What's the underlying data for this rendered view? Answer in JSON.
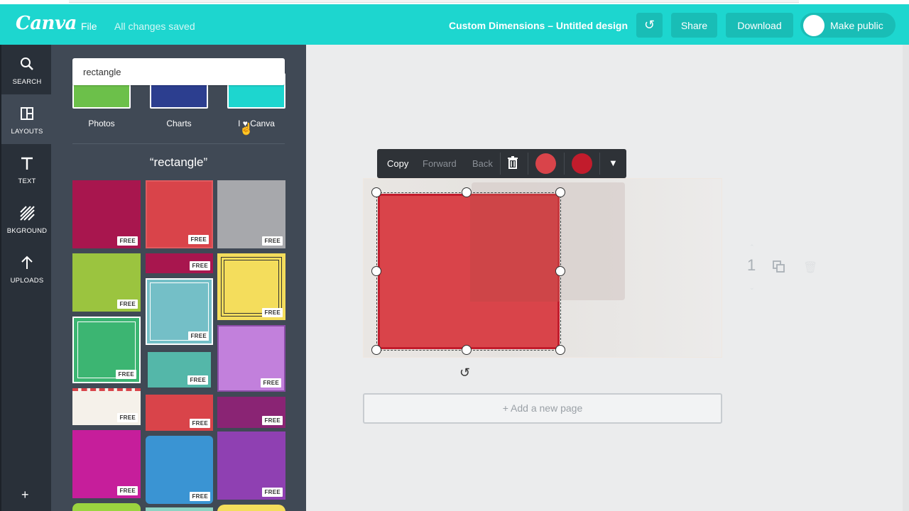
{
  "header": {
    "logo": "Canva",
    "file_label": "File",
    "saved_status": "All changes saved",
    "doc_title": "Custom Dimensions – Untitled design",
    "undo_icon": "undo-icon",
    "share_label": "Share",
    "download_label": "Download",
    "public_label": "Make public",
    "brand_color": "#1dd6cf"
  },
  "sidebar": {
    "items": [
      {
        "label": "SEARCH",
        "icon": "search-icon"
      },
      {
        "label": "LAYOUTS",
        "icon": "layouts-icon"
      },
      {
        "label": "TEXT",
        "icon": "text-icon"
      },
      {
        "label": "BKGROUND",
        "icon": "background-icon"
      },
      {
        "label": "UPLOADS",
        "icon": "upload-icon"
      }
    ],
    "add_icon": "+"
  },
  "panel": {
    "search_value": "rectangle",
    "categories": [
      {
        "label": "Photos",
        "color": "#6cc04a"
      },
      {
        "label": "Charts",
        "color": "#2c3e8f"
      },
      {
        "label": "I ♥ Canva",
        "color": "#1dd6cf"
      }
    ],
    "result_title": "“rectangle”",
    "free_badge": "FREE",
    "tiles": [
      {
        "color": "#a8164e"
      },
      {
        "color": "#d9444a"
      },
      {
        "color": "#a7a8ac"
      },
      {
        "color": "#9bc43f"
      },
      {
        "color": "#a8164e"
      },
      {
        "color": "#74bfc7"
      },
      {
        "color": "#f4dd5c"
      },
      {
        "color": "#3cb572"
      },
      {
        "color": "#54b7a9"
      },
      {
        "color": "#c280dc"
      },
      {
        "color": "#f5f1ea"
      },
      {
        "color": "#d9444a"
      },
      {
        "color": "#8a2474"
      },
      {
        "color": "#c61e9b"
      },
      {
        "color": "#3a94d3"
      },
      {
        "color": "#8f40b2"
      }
    ]
  },
  "toolbar": {
    "copy": "Copy",
    "forward": "Forward",
    "back": "Back",
    "trash_icon": "trash-icon",
    "swatch1": "#d9444a",
    "swatch2": "#c21c2c",
    "more_icon": "chevron-down-icon"
  },
  "canvas": {
    "page_number": "1",
    "add_page": "+ Add a new page"
  }
}
